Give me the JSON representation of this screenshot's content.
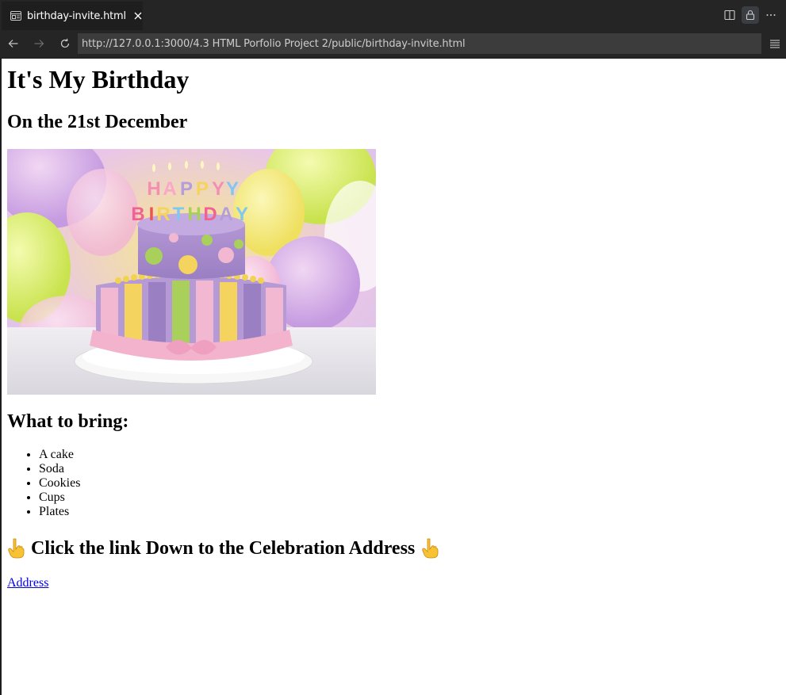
{
  "browser": {
    "tab": {
      "title": "birthday-invite.html",
      "icon": "preview-icon",
      "close_icon": "close-icon"
    },
    "toolbar_actions": [
      {
        "name": "split-editor-icon"
      },
      {
        "name": "lock-icon",
        "active": true
      },
      {
        "name": "more-icon"
      }
    ],
    "nav": {
      "back_icon": "arrow-left-icon",
      "forward_icon": "arrow-right-icon",
      "reload_icon": "reload-icon",
      "url": "http://127.0.0.1:3000/4.3 HTML Porfolio Project 2/public/birthday-invite.html",
      "menu_icon": "hamburger-icon"
    }
  },
  "page": {
    "title": "It's My Birthday",
    "date_heading": "On the 21st December",
    "image": {
      "description_icon": "birthday-cake-image",
      "cake_topper_text": "HAPPY BIRTHDAY"
    },
    "bring_heading": "What to bring:",
    "bring_items": [
      "A cake",
      "Soda",
      "Cookies",
      "Cups",
      "Plates"
    ],
    "click_heading": "Click the link Down to the Celebration Address",
    "hand_icon": "pointing-down-hand-icon",
    "link_text": "Address"
  },
  "colors": {
    "chrome_bg": "#252526",
    "url_bg": "#3c3c3c",
    "page_bg": "#ffffff",
    "link": "#0000ee"
  }
}
